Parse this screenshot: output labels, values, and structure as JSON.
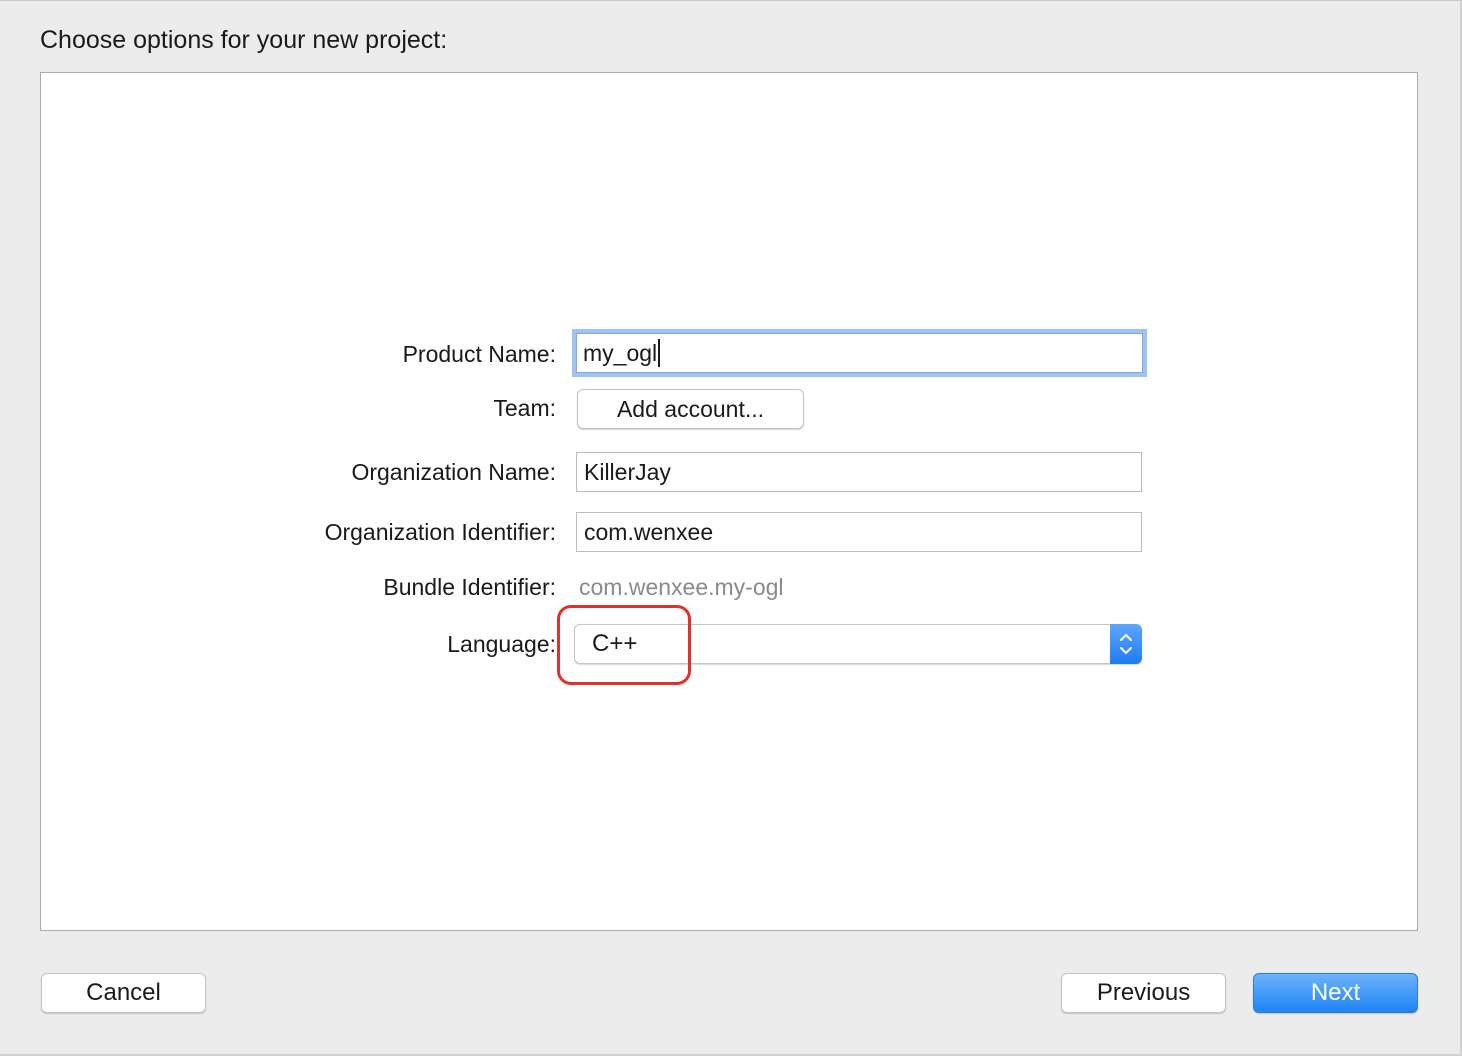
{
  "dialog": {
    "heading": "Choose options for your new project:"
  },
  "form": {
    "product_name": {
      "label": "Product Name:",
      "value": "my_ogl"
    },
    "team": {
      "label": "Team:",
      "button_label": "Add account..."
    },
    "organization_name": {
      "label": "Organization Name:",
      "value": "KillerJay"
    },
    "organization_identifier": {
      "label": "Organization Identifier:",
      "value": "com.wenxee"
    },
    "bundle_identifier": {
      "label": "Bundle Identifier:",
      "value": "com.wenxee.my-ogl"
    },
    "language": {
      "label": "Language:",
      "selected": "C++"
    }
  },
  "footer": {
    "cancel_label": "Cancel",
    "previous_label": "Previous",
    "next_label": "Next"
  },
  "colors": {
    "accent": "#1f84f5",
    "focus_ring": "#9ec4f2",
    "annotation": "#e0312f"
  },
  "icons": {
    "language_popup_arrows": "chevron-up-down-icon"
  }
}
